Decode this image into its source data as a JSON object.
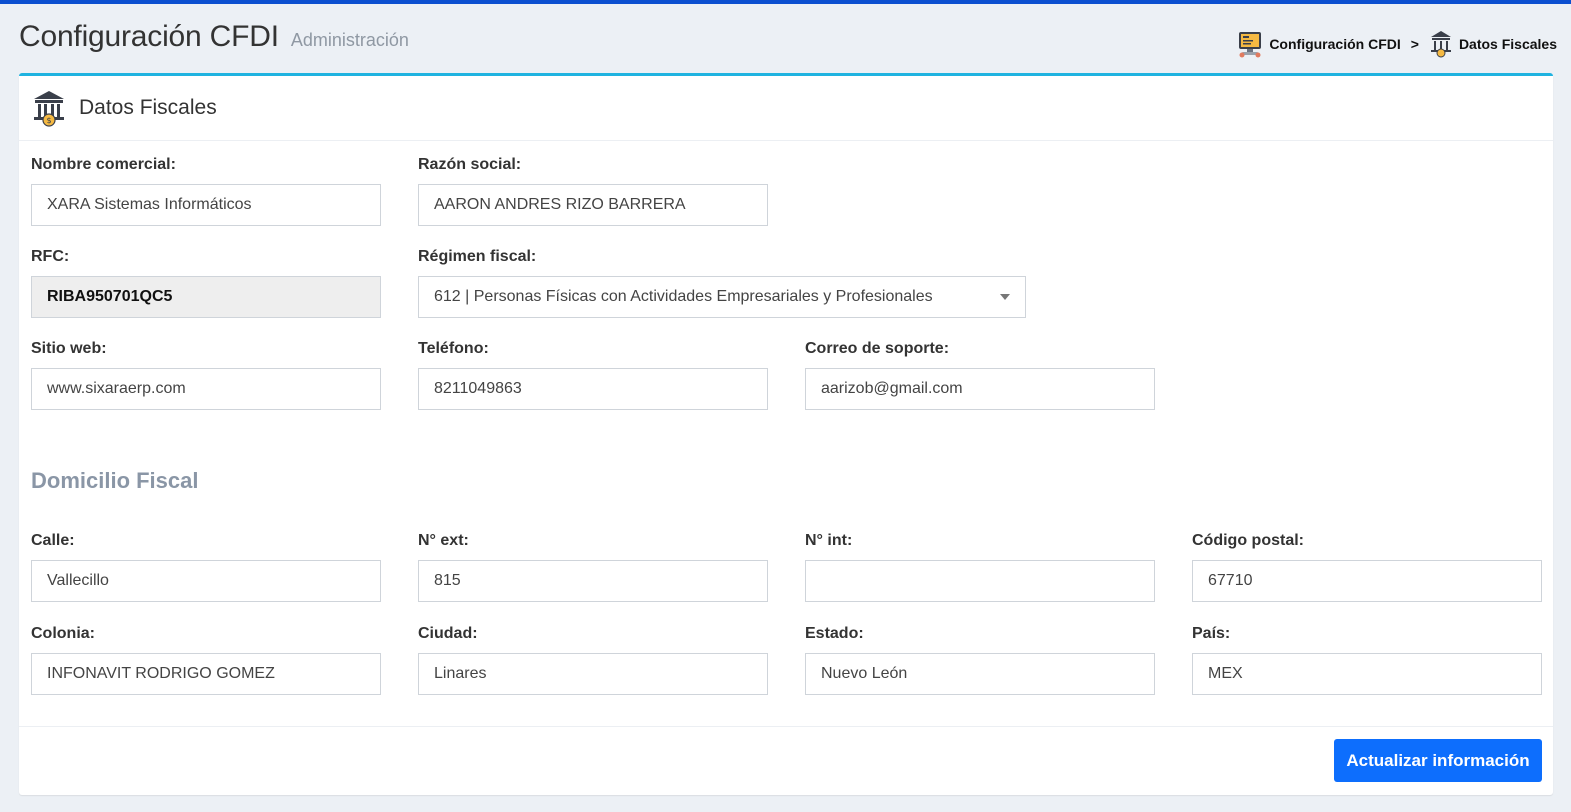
{
  "header": {
    "title": "Configuración CFDI",
    "subtitle": "Administración"
  },
  "breadcrumb": {
    "items": [
      {
        "label": "Configuración CFDI",
        "icon": "computer-invoice-icon"
      },
      {
        "label": "Datos Fiscales",
        "icon": "bank-icon"
      }
    ],
    "separator": ">"
  },
  "card": {
    "title": "Datos Fiscales",
    "icon": "bank-icon"
  },
  "form": {
    "nombre_comercial": {
      "label": "Nombre comercial:",
      "value": "XARA Sistemas Informáticos"
    },
    "razon_social": {
      "label": "Razón social:",
      "value": "AARON ANDRES RIZO BARRERA"
    },
    "rfc": {
      "label": "RFC:",
      "value": "RIBA950701QC5"
    },
    "regimen_fiscal": {
      "label": "Régimen fiscal:",
      "value": "612 | Personas Físicas con Actividades Empresariales y Profesionales"
    },
    "sitio_web": {
      "label": "Sitio web:",
      "value": "www.sixaraerp.com"
    },
    "telefono": {
      "label": "Teléfono:",
      "value": "8211049863"
    },
    "correo_soporte": {
      "label": "Correo de soporte:",
      "value": "aarizob@gmail.com"
    }
  },
  "domicilio": {
    "section_title": "Domicilio Fiscal",
    "calle": {
      "label": "Calle:",
      "value": "Vallecillo"
    },
    "num_ext": {
      "label": "N° ext:",
      "value": "815"
    },
    "num_int": {
      "label": "N° int:",
      "value": ""
    },
    "codigo_postal": {
      "label": "Código postal:",
      "value": "67710"
    },
    "colonia": {
      "label": "Colonia:",
      "value": "INFONAVIT RODRIGO GOMEZ"
    },
    "ciudad": {
      "label": "Ciudad:",
      "value": "Linares"
    },
    "estado": {
      "label": "Estado:",
      "value": "Nuevo León"
    },
    "pais": {
      "label": "País:",
      "value": "MEX"
    }
  },
  "footer": {
    "submit_label": "Actualizar información"
  },
  "colors": {
    "accent": "#0d6efd",
    "top_strip": "#0b4fd0",
    "card_border": "#1fb3e0",
    "section_title": "#8a96a6"
  }
}
